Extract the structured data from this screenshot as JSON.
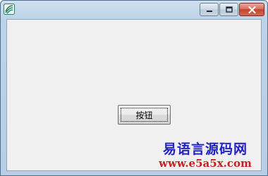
{
  "window": {
    "title": "",
    "caption_buttons": [
      "minimize",
      "maximize",
      "close"
    ]
  },
  "form": {
    "button_label": "按钮"
  },
  "watermark": {
    "title": "易语言源码网",
    "url": "www.e5a5x.com"
  },
  "icons": {
    "app": "app-icon",
    "minimize": "minimize-icon",
    "maximize": "maximize-icon",
    "close": "close-icon"
  },
  "colors": {
    "titlebar": "#bcd3e8",
    "client": "#f0f0f0",
    "close_button": "#c4412d",
    "watermark_title": "#2222c4",
    "watermark_url": "#c42222"
  }
}
